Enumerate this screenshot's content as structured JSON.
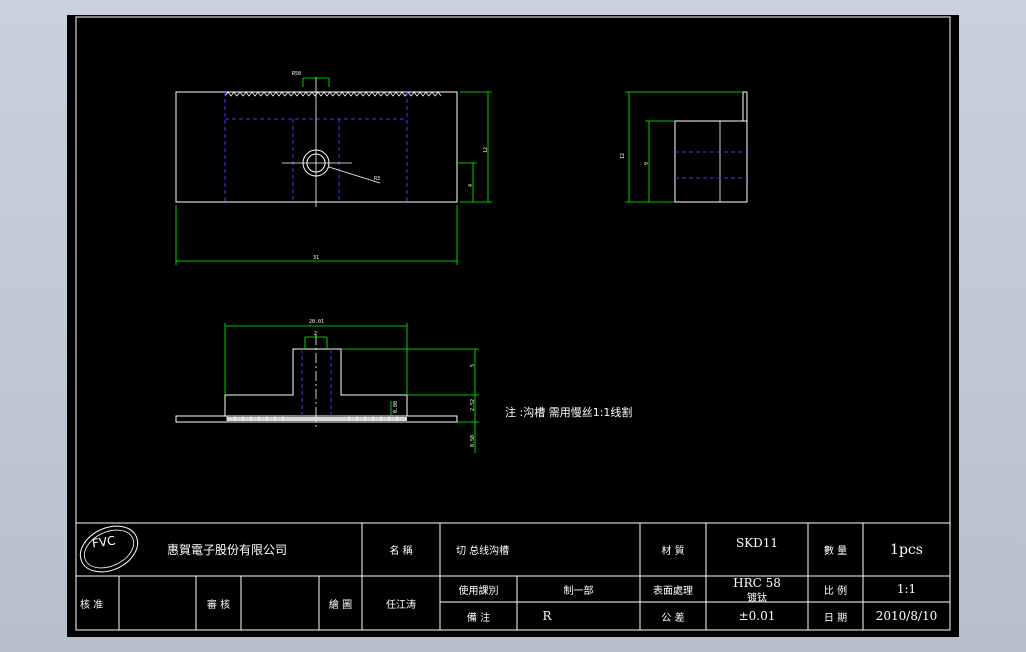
{
  "titleblock": {
    "company": "惠賀電子股份有限公司",
    "logo": "FVC",
    "name_label": "名 稱",
    "name_value": "切 总线沟槽",
    "material_label": "材 質",
    "material_value": "SKD11",
    "qty_label": "數 量",
    "qty_value": "1pcs",
    "check_label": "核 准",
    "review_label": "審 核",
    "draw_label": "繪 圖",
    "drawer_value": "任江涛",
    "usage_label": "使用課別",
    "usage_value": "制一部",
    "surface_label": "表面處理",
    "surface_value_1": "HRC 58",
    "surface_value_2": "镀钛",
    "scale_label": "比 例",
    "scale_value": "1:1",
    "remark_label": "備 注",
    "remark_value": "R",
    "tolerance_label": "公 差",
    "tolerance_value": "±0.01",
    "date_label": "日 期",
    "date_value": "2010/8/10"
  },
  "note": "注 :沟槽 需用慢丝1:1线割",
  "dimensions": {
    "top_small": "R50",
    "top_width": "31",
    "top_height": "12",
    "top_inner": "4",
    "radius": "R3",
    "side_height": "12",
    "side_inner": "9",
    "front_width": "20.01",
    "front_inner": "2",
    "front_h1": "5",
    "front_h2": "2.52",
    "front_h3": "0.80",
    "front_h4": "0.50"
  },
  "colors": {
    "background": "#000000",
    "outline": "#ffffff",
    "dimension": "#00ff00",
    "hidden": "#3a3aff"
  }
}
